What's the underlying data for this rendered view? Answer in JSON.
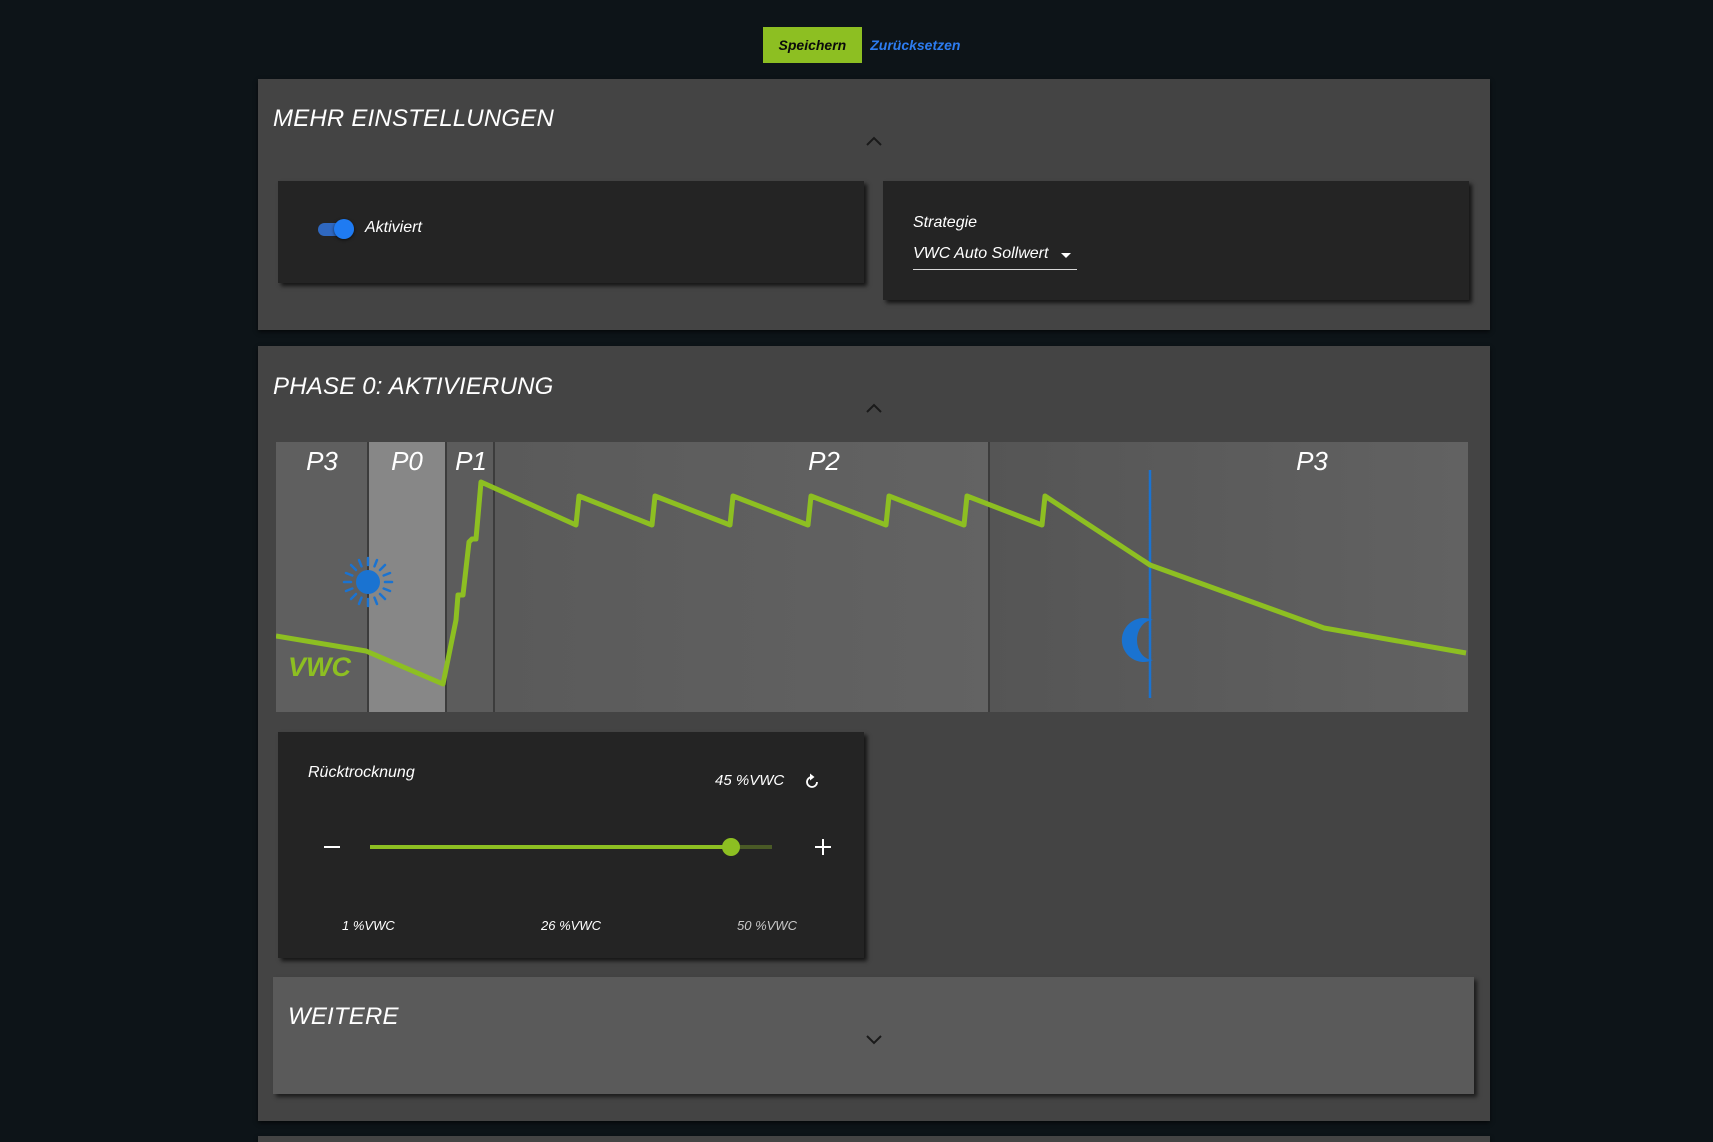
{
  "toolbar": {
    "save_label": "Speichern",
    "reset_label": "Zurücksetzen"
  },
  "settings_panel": {
    "title": "MEHR EINSTELLUNGEN",
    "collapse_icon": "chevron-up-icon",
    "toggle": {
      "label": "Aktiviert",
      "checked": true
    },
    "strategy": {
      "label": "Strategie",
      "value": "VWC Auto Sollwert"
    }
  },
  "phase_panel": {
    "title": "PHASE 0: AKTIVIERUNG",
    "collapse_icon": "chevron-up-icon",
    "diagram": {
      "phase_labels": [
        "P3",
        "P0",
        "P1",
        "P2",
        "P3"
      ],
      "curve_label": "VWC",
      "icons": [
        "sun-icon",
        "moon-icon"
      ]
    },
    "slider": {
      "label": "Rücktrocknung",
      "value_text": "45 %VWC",
      "value": 45,
      "min": 1,
      "max": 50,
      "min_label": "1 %VWC",
      "mid_label": "26 %VWC",
      "max_label": "50 %VWC"
    },
    "more": {
      "title": "WEITERE",
      "expand_icon": "chevron-down-icon"
    }
  },
  "colors": {
    "accent_green": "#8dbf22",
    "accent_blue": "#1f7bf2",
    "link_blue": "#2d7cf0",
    "background": "#0d1418",
    "panel": "#444444",
    "card": "#242424"
  }
}
